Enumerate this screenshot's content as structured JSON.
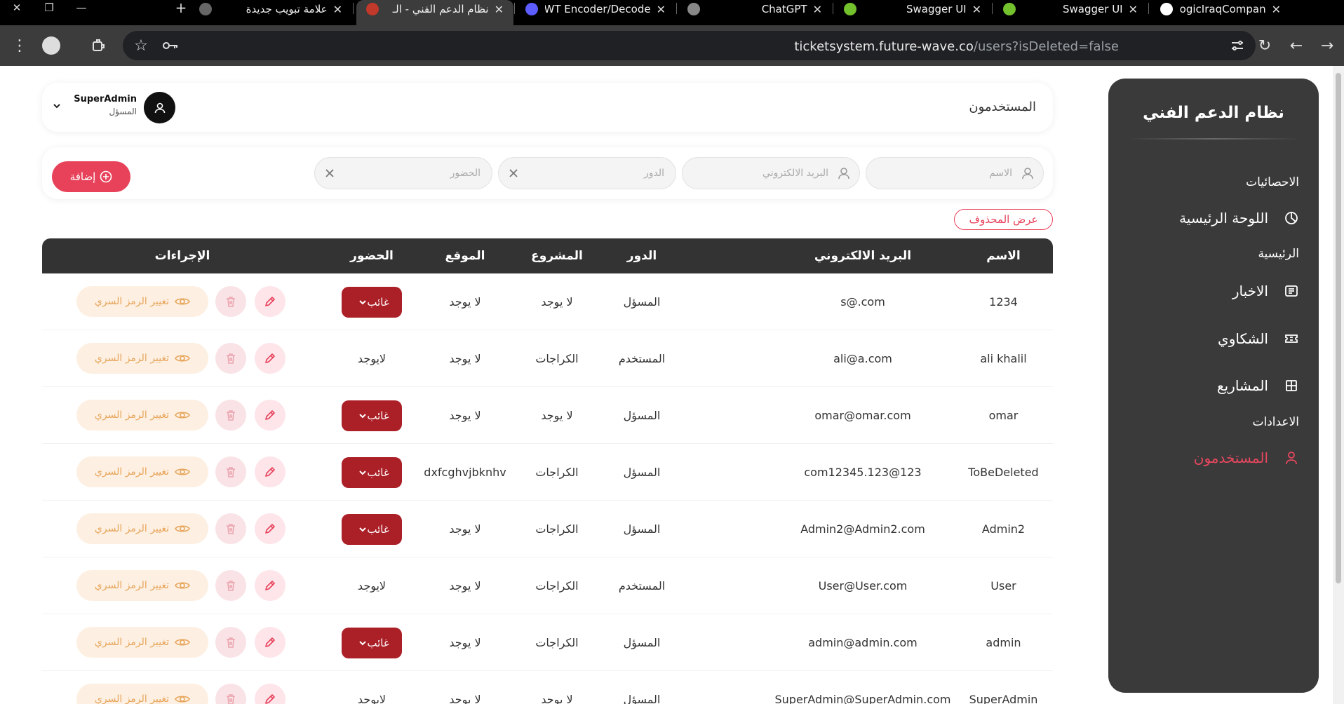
{
  "browser": {
    "tabs": [
      {
        "title": "علامة تبويب جديدة",
        "icon": "chrome-icon"
      },
      {
        "title": "نظام الدعم الفني - الـ",
        "icon": "app-flag-icon",
        "active": true
      },
      {
        "title": "JWT Encoder/Decode",
        "icon": "jwt-icon"
      },
      {
        "title": "ChatGPT",
        "icon": "openai-icon"
      },
      {
        "title": "Swagger UI",
        "icon": "swagger-icon"
      },
      {
        "title": "Swagger UI",
        "icon": "swagger-icon"
      },
      {
        "title": "TheLogicIraqCompan",
        "icon": "github-icon"
      }
    ],
    "url_host": "ticketsystem.future-wave.co",
    "url_path": "/users?isDeleted=false"
  },
  "sidebar": {
    "title": "نظام الدعم الفني",
    "sections": {
      "stats": "الاحصائيات",
      "main": "الرئيسية",
      "settings": "الاعدادات"
    },
    "items": {
      "dashboard": "اللوحة الرئيسية",
      "news": "الاخبار",
      "complaints": "الشكاوي",
      "projects": "المشاريع",
      "users": "المستخدمون"
    },
    "active_color": "#e8475f"
  },
  "header": {
    "title": "المستخدمون",
    "user_name": "SuperAdmin",
    "user_role": "المسؤل"
  },
  "filters": {
    "name_placeholder": "الاسم",
    "email_placeholder": "البريد الالكتروني",
    "role_placeholder": "الدور",
    "attendance_placeholder": "الحضور",
    "add_label": "إضافة"
  },
  "show_deleted_label": "عرض المحذوف",
  "table": {
    "headers": {
      "name": "الاسم",
      "email": "البريد الالكتروني",
      "role": "الدور",
      "project": "المشروع",
      "location": "الموقع",
      "attendance": "الحضور",
      "actions": "الإجراءات"
    },
    "change_password_label": "تغيير الرمز السري",
    "rows": [
      {
        "name": "1234",
        "email": "s@.com",
        "role": "المسؤل",
        "project": "لا يوجد",
        "location": "لا يوجد",
        "attendance": "غائب",
        "absent": true
      },
      {
        "name": "ali khalil",
        "email": "ali@a.com",
        "role": "المستخدم",
        "project": "الكراجات",
        "location": "لا يوجد",
        "attendance": "لايوجد",
        "absent": false
      },
      {
        "name": "omar",
        "email": "omar@omar.com",
        "role": "المسؤل",
        "project": "لا يوجد",
        "location": "لا يوجد",
        "attendance": "غائب",
        "absent": true
      },
      {
        "name": "ToBeDeleted",
        "email": "com12345.123@123",
        "role": "المسؤل",
        "project": "الكراجات",
        "location": "dxfcghvjbknhv",
        "attendance": "غائب",
        "absent": true
      },
      {
        "name": "Admin2",
        "email": "Admin2@Admin2.com",
        "role": "المسؤل",
        "project": "الكراجات",
        "location": "لا يوجد",
        "attendance": "غائب",
        "absent": true
      },
      {
        "name": "User",
        "email": "User@User.com",
        "role": "المستخدم",
        "project": "الكراجات",
        "location": "لا يوجد",
        "attendance": "لايوجد",
        "absent": false
      },
      {
        "name": "admin",
        "email": "admin@admin.com",
        "role": "المسؤل",
        "project": "الكراجات",
        "location": "لا يوجد",
        "attendance": "غائب",
        "absent": true
      },
      {
        "name": "SuperAdmin",
        "email": "SuperAdmin@SuperAdmin.com",
        "role": "المسؤل",
        "project": "لا يوجد",
        "location": "لا يوجد",
        "attendance": "لايوجد",
        "absent": false
      }
    ]
  },
  "colors": {
    "primary": "#e8415a",
    "absent_badge": "#ab1f27",
    "sidebar_bg": "#3a3a3a",
    "table_header_bg": "#333333",
    "change_password_text": "#e7a45a"
  }
}
